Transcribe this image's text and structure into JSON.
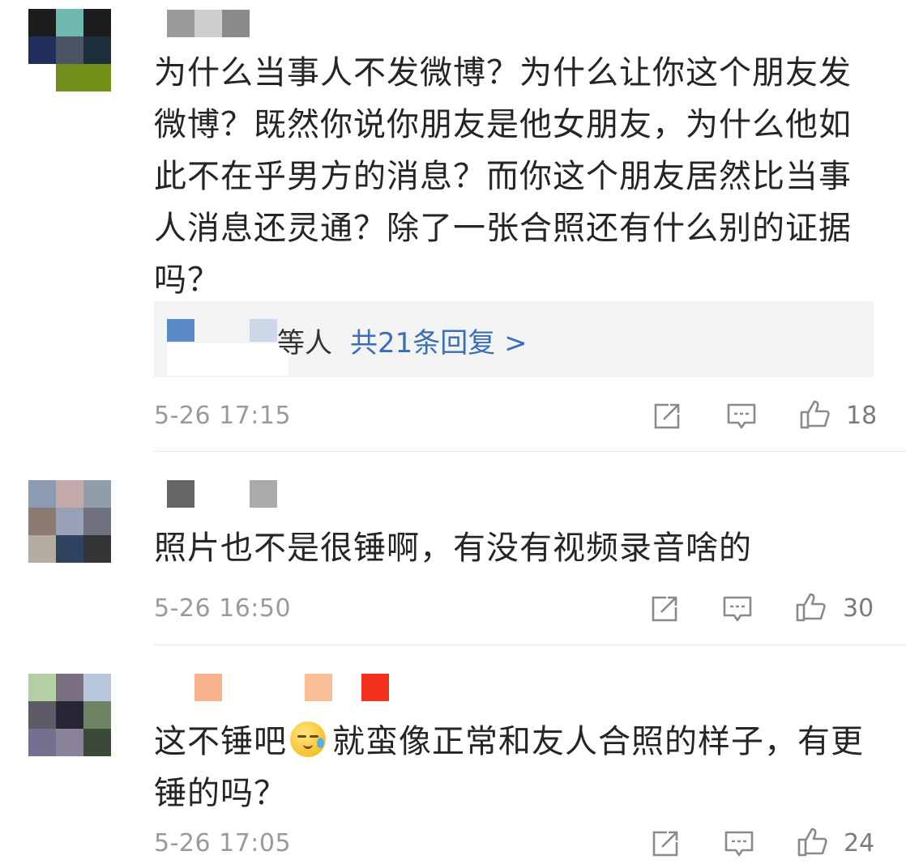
{
  "comments": [
    {
      "text": "为什么当事人不发微博？为什么让你这个朋友发微博？既然你说你朋友是他女朋友，为什么他如此不在乎男方的消息？而你这个朋友居然比当事人消息还灵通？除了一张合照还有什么别的证据吗？",
      "reply_prefix": "等人",
      "reply_link": "共21条回复 >",
      "timestamp": "5-26 17:15",
      "likes": "18"
    },
    {
      "text": "照片也不是很锤啊，有没有视频录音啥的",
      "timestamp": "5-26 16:50",
      "likes": "30"
    },
    {
      "text_before_emoji": "这不锤吧",
      "emoji": "sweat-emoji",
      "text_after_emoji": "就蛮像正常和友人合照的样子，有更锤的吗？",
      "timestamp": "5-26 17:05",
      "likes": "24"
    }
  ],
  "icons": {
    "share": "share-icon",
    "comment": "comment-icon",
    "like": "like-icon"
  },
  "colors": {
    "link": "#3a6fb5",
    "meta": "#9a9a9a",
    "reply_bg": "#f3f3f3"
  }
}
